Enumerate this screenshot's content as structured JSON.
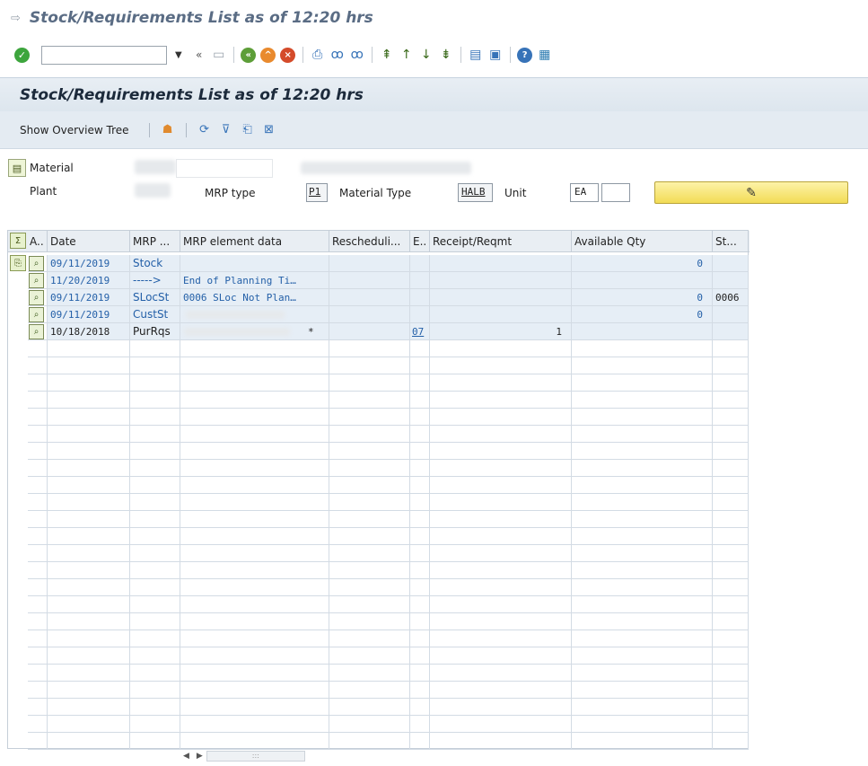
{
  "window": {
    "title": "Stock/Requirements List as of 12:20 hrs"
  },
  "toolbar": {
    "command_placeholder": ""
  },
  "header": {
    "title": "Stock/Requirements List as of 12:20 hrs",
    "show_overview_tree": "Show Overview Tree"
  },
  "fields": {
    "material_label": "Material",
    "plant_label": "Plant",
    "mrp_type_label": "MRP type",
    "mrp_type_value": "P1",
    "material_type_label": "Material Type",
    "material_type_value": "HALB",
    "unit_label": "Unit",
    "unit_value": "EA"
  },
  "grid": {
    "columns": [
      "A..",
      "Date",
      "MRP ...",
      "MRP element data",
      "Rescheduli...",
      "E..",
      "Receipt/Reqmt",
      "Available Qty",
      "St..."
    ],
    "rows": [
      {
        "date": "09/11/2019",
        "mrp": "Stock",
        "element": "",
        "resch": "",
        "e": "",
        "receipt": "",
        "avail": "0",
        "st": ""
      },
      {
        "date": "11/20/2019",
        "mrp": "----->",
        "element": "End of Planning Ti…",
        "resch": "",
        "e": "",
        "receipt": "",
        "avail": "",
        "st": ""
      },
      {
        "date": "09/11/2019",
        "mrp": "SLocSt",
        "element": "0006 SLoc Not Plan…",
        "resch": "",
        "e": "",
        "receipt": "",
        "avail": "0",
        "st": "0006"
      },
      {
        "date": "09/11/2019",
        "mrp": "CustSt",
        "element": "",
        "resch": "",
        "e": "",
        "receipt": "",
        "avail": "0",
        "st": ""
      },
      {
        "date": "10/18/2018",
        "mrp": "PurRqs",
        "element": "*",
        "resch": "",
        "e": "07",
        "receipt": "1",
        "avail": "",
        "st": ""
      }
    ]
  }
}
